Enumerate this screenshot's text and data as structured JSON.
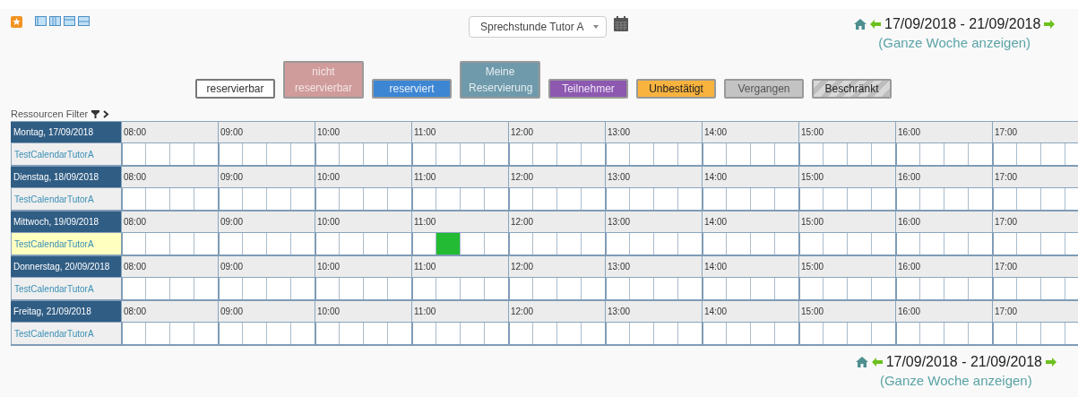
{
  "resource_select": {
    "value": "Sprechstunde Tutor A"
  },
  "nav_top": {
    "range": "17/09/2018 - 21/09/2018",
    "link": "(Ganze Woche anzeigen)"
  },
  "legend": [
    {
      "kind": "free",
      "label": "reservierbar"
    },
    {
      "kind": "blocked",
      "label": "nicht reservierbar"
    },
    {
      "kind": "reserved",
      "label": "reserviert"
    },
    {
      "kind": "mine",
      "label": "Meine Reservierung"
    },
    {
      "kind": "participant",
      "label": "Teilnehmer"
    },
    {
      "kind": "pending",
      "label": "Unbestätigt"
    },
    {
      "kind": "past",
      "label": "Vergangen"
    },
    {
      "kind": "restricted",
      "label": "Beschränkt"
    }
  ],
  "filter": {
    "label": "Ressourcen Filter"
  },
  "days": [
    {
      "label": "Montag, 17/09/2018",
      "resource": "TestCalendarTutorA",
      "selected": false,
      "hours": [
        {
          "label": "08:00"
        },
        {
          "label": "09:00"
        },
        {
          "label": "10:00"
        },
        {
          "label": "11:00"
        },
        {
          "label": "12:00"
        },
        {
          "label": "13:00"
        },
        {
          "label": "14:00"
        },
        {
          "label": "15:00"
        },
        {
          "label": "16:00"
        },
        {
          "label": "17:00"
        }
      ]
    },
    {
      "label": "Dienstag, 18/09/2018",
      "resource": "TestCalendarTutorA",
      "selected": false,
      "hours": [
        {
          "label": "08:00"
        },
        {
          "label": "09:00"
        },
        {
          "label": "10:00"
        },
        {
          "label": "11:00"
        },
        {
          "label": "12:00"
        },
        {
          "label": "13:00"
        },
        {
          "label": "14:00"
        },
        {
          "label": "15:00"
        },
        {
          "label": "16:00"
        },
        {
          "label": "17:00"
        }
      ]
    },
    {
      "label": "Mittwoch, 19/09/2018",
      "resource": "TestCalendarTutorA",
      "selected": true,
      "hours": [
        {
          "label": "08:00"
        },
        {
          "label": "09:00"
        },
        {
          "label": "10:00"
        },
        {
          "label": "11:00",
          "slots": [
            {
              "booked": false
            },
            {
              "booked": true
            },
            {
              "booked": false
            },
            {
              "booked": false
            }
          ]
        },
        {
          "label": "12:00"
        },
        {
          "label": "13:00"
        },
        {
          "label": "14:00"
        },
        {
          "label": "15:00"
        },
        {
          "label": "16:00"
        },
        {
          "label": "17:00"
        }
      ]
    },
    {
      "label": "Donnerstag, 20/09/2018",
      "resource": "TestCalendarTutorA",
      "selected": false,
      "hours": [
        {
          "label": "08:00"
        },
        {
          "label": "09:00"
        },
        {
          "label": "10:00"
        },
        {
          "label": "11:00"
        },
        {
          "label": "12:00"
        },
        {
          "label": "13:00"
        },
        {
          "label": "14:00"
        },
        {
          "label": "15:00"
        },
        {
          "label": "16:00"
        },
        {
          "label": "17:00"
        }
      ]
    },
    {
      "label": "Freitag, 21/09/2018",
      "resource": "TestCalendarTutorA",
      "selected": false,
      "hours": [
        {
          "label": "08:00"
        },
        {
          "label": "09:00"
        },
        {
          "label": "10:00"
        },
        {
          "label": "11:00"
        },
        {
          "label": "12:00"
        },
        {
          "label": "13:00"
        },
        {
          "label": "14:00"
        },
        {
          "label": "15:00"
        },
        {
          "label": "16:00"
        },
        {
          "label": "17:00"
        }
      ]
    }
  ],
  "nav_bottom": {
    "range": "17/09/2018 - 21/09/2018",
    "link": "(Ganze Woche anzeigen)"
  }
}
